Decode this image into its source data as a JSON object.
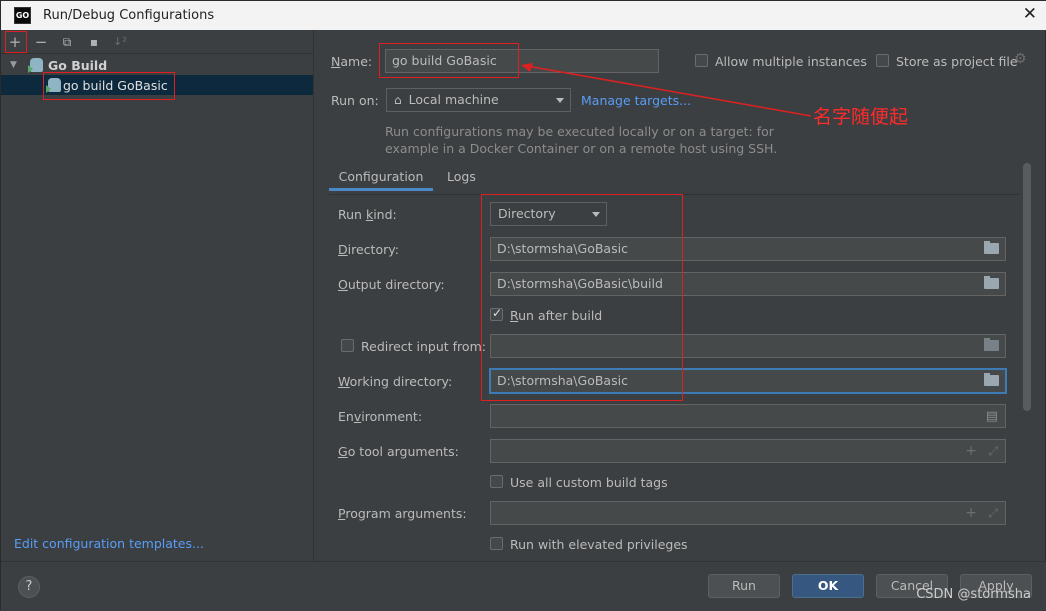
{
  "window": {
    "app_icon": "GO",
    "title": "Run/Debug Configurations",
    "close": "✕"
  },
  "left_toolbar": {
    "add": "+",
    "remove": "−",
    "copy": "⧉",
    "folder": "▪",
    "sort": "↓²"
  },
  "tree": {
    "group_label": "Go Build",
    "item_label": "go build GoBasic"
  },
  "left_link": "Edit configuration templates...",
  "name_label": "Name:",
  "name_value": "go build GoBasic",
  "allow_multiple": "Allow multiple instances",
  "store_as_project": "Store as project file",
  "run_on_label": "Run on:",
  "run_on_value": "Local machine",
  "manage_targets": "Manage targets...",
  "run_on_hint_1": "Run configurations may be executed locally or on a target: for",
  "run_on_hint_2": "example in a Docker Container or on a remote host using SSH.",
  "annotation": "名字随便起",
  "tabs": [
    "Configuration",
    "Logs"
  ],
  "form": {
    "run_kind_label": "Run kind:",
    "run_kind_value": "Directory",
    "directory_label": "Directory:",
    "directory_value": "D:\\stormsha\\GoBasic",
    "output_label": "Output directory:",
    "output_value": "D:\\stormsha\\GoBasic\\build",
    "run_after_build": "Run after build",
    "redirect_label": "Redirect input from:",
    "working_dir_label": "Working directory:",
    "working_dir_value": "D:\\stormsha\\GoBasic",
    "environment_label": "Environment:",
    "go_tool_label": "Go tool arguments:",
    "custom_build_tags": "Use all custom build tags",
    "program_args_label": "Program arguments:",
    "elevated": "Run with elevated privileges"
  },
  "buttons": {
    "help": "?",
    "run": "Run",
    "ok": "OK",
    "cancel": "Cancel",
    "apply": "Apply"
  },
  "watermark": "CSDN @stormsha"
}
